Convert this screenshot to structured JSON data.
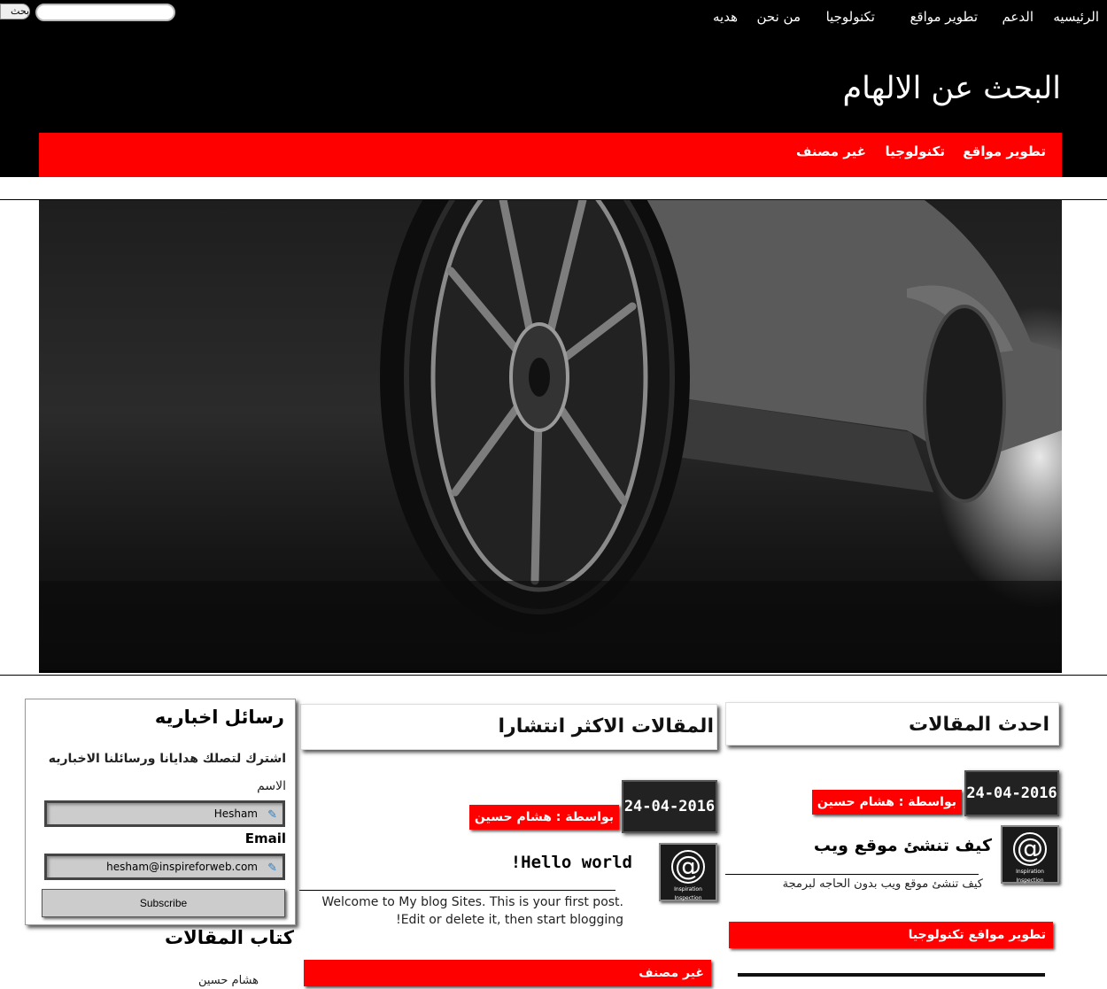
{
  "search": {
    "placeholder": "",
    "button_label": "بحث"
  },
  "top_nav": [
    "الرئيسيه",
    "الدعم",
    "تطوير مواقع",
    "تكنولوجيا",
    "من نحن",
    "هديه"
  ],
  "site_title": "البحث عن الالهام",
  "categories": [
    "تطوير مواقع",
    "تكنولوجيا",
    "غير مصنف"
  ],
  "latest": {
    "heading": "احدث المقالات",
    "date": "24-04-2016",
    "author": "بواسطة : هشام حسين",
    "post_title": "كيف تنشئ موقع ويب",
    "excerpt": "كيف تنشئ موقع ويب بدون الحاجه لبرمجة",
    "tags": "تطوير مواقع تكنولوجيا"
  },
  "popular": {
    "heading": "المقالات الاكثر انتشارا",
    "date": "24-04-2016",
    "author": "بواسطة : هشام حسين",
    "post_title": "!Hello world",
    "excerpt_line1": "Welcome to My blog Sites. This is your first post.",
    "excerpt_line2": "!Edit or delete it, then start blogging",
    "category": "غير مصنف"
  },
  "thumb": {
    "caption1": "Inspiration",
    "caption2": "Inspection"
  },
  "newsletter": {
    "heading": "رسائل اخباريه",
    "description": "اشترك لتصلك هدايانا ورسائلنا الاخباريه",
    "name_label": "الاسم",
    "name_value": "Hesham",
    "email_label": "Email",
    "email_value": "hesham@inspireforweb.com",
    "subscribe_label": "Subscribe"
  },
  "authors": {
    "heading": "كتاب المقالات",
    "names": [
      "هشام حسين"
    ]
  }
}
